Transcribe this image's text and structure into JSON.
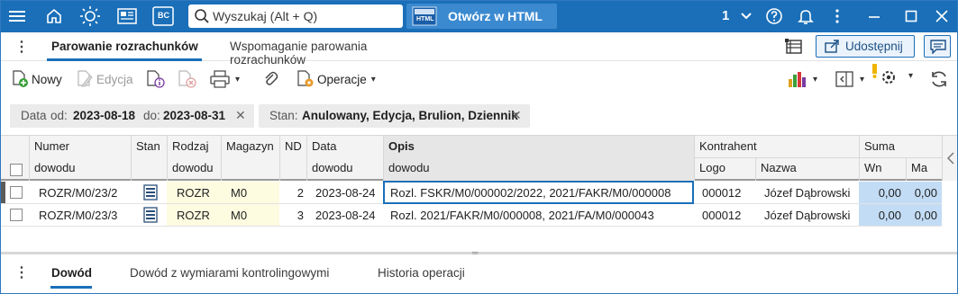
{
  "titlebar": {
    "menu_icon": "hamburger-icon",
    "search_placeholder": "Wyszukaj (Alt + Q)",
    "html_icon_text": "HTML",
    "html_button_label": "Otwórz w HTML",
    "bc_text": "BC",
    "company_count": "1"
  },
  "tabs": {
    "items": [
      "Parowanie rozrachunków",
      "Wspomaganie parowania rozrachunków"
    ],
    "active_index": 0,
    "share_label": "Udostępnij"
  },
  "toolbar": {
    "new_label": "Nowy",
    "edit_label": "Edycja",
    "operations_label": "Operacje"
  },
  "filters": [
    {
      "key1": "Data",
      "k_od": "od:",
      "v_od": "2023-08-18",
      "k_do": "do:",
      "v_do": "2023-08-31"
    },
    {
      "key": "Stan:",
      "value": "Anulowany, Edycja, Brulion, Dziennik"
    }
  ],
  "grid": {
    "headers_top": {
      "numer": "Numer",
      "stan": "Stan",
      "rodzaj": "Rodzaj",
      "magazyn": "Magazyn",
      "nd": "ND",
      "data": "Data",
      "opis": "Opis",
      "kontrahent": "Kontrahent",
      "suma": "Suma"
    },
    "headers_bottom": {
      "numer": "dowodu",
      "rodzaj": "dowodu",
      "data": "dowodu",
      "opis": "dowodu",
      "logo": "Logo",
      "nazwa": "Nazwa",
      "wn": "Wn",
      "ma": "Ma"
    },
    "rows": [
      {
        "numer": "ROZR/M0/23/2",
        "rodzaj": "ROZR",
        "magazyn": "M0",
        "nd": "2",
        "data": "2023-08-24",
        "opis": "Rozl. FSKR/M0/000002/2022, 2021/FAKR/M0/000008",
        "logo": "000012",
        "nazwa": "Józef Dąbrowski",
        "wn": "0,00",
        "ma": "0,00"
      },
      {
        "numer": "ROZR/M0/23/3",
        "rodzaj": "ROZR",
        "magazyn": "M0",
        "nd": "3",
        "data": "2023-08-24",
        "opis": "Rozl. 2021/FAKR/M0/000008, 2021/FA/M0/000043",
        "logo": "000012",
        "nazwa": "Józef Dąbrowski",
        "wn": "0,00",
        "ma": "0,00"
      }
    ]
  },
  "bottom_tabs": {
    "items": [
      "Dowód",
      "Dowód z wymiarami kontrolingowymi",
      "Historia operacji"
    ],
    "active_index": 0
  },
  "colors": {
    "titlebar": "#1a6fb8",
    "accent": "#1a6fb8",
    "yellow_cell": "#fdfbe0",
    "blue_cell": "#c3dcf5"
  }
}
